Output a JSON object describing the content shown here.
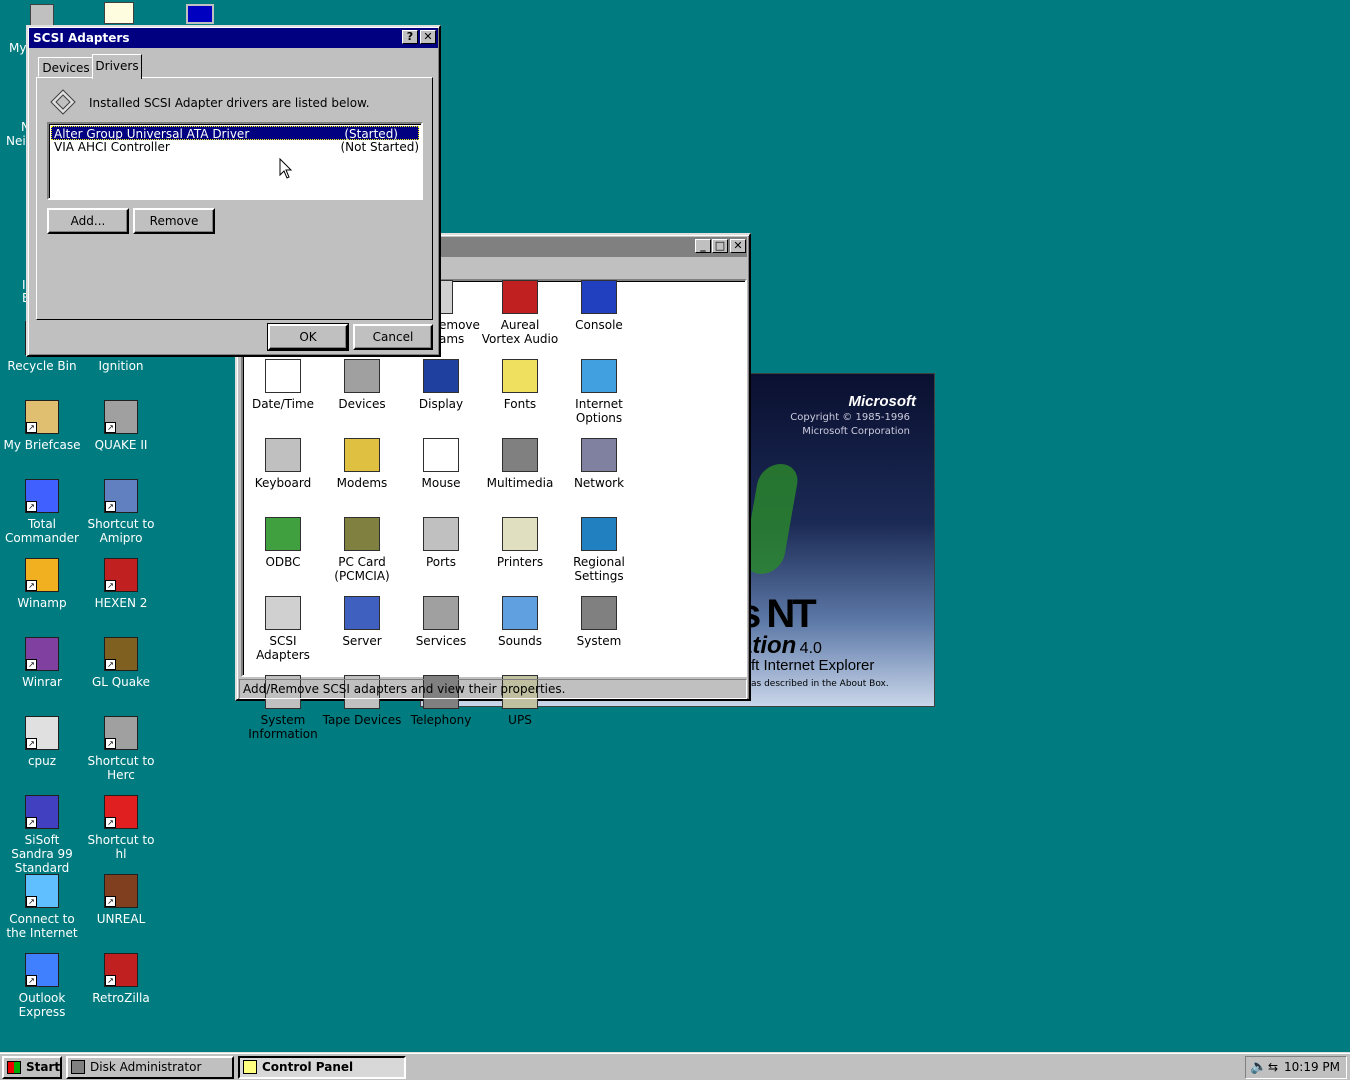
{
  "desktop": {
    "partial_labels": {
      "my": "My",
      "nei": "Nei",
      "n": "N",
      "e": "E",
      "l": "I"
    },
    "icons": [
      {
        "label": "Recycle Bin",
        "icon": "recycle-bin-icon"
      },
      {
        "label": "Ignition",
        "icon": "ignition-icon"
      },
      {
        "label": "My Briefcase",
        "icon": "briefcase-icon"
      },
      {
        "label": "QUAKE II",
        "icon": "quake2-icon"
      },
      {
        "label": "Total Commander",
        "icon": "total-commander-icon"
      },
      {
        "label": "Shortcut to Amipro",
        "icon": "amipro-icon"
      },
      {
        "label": "Winamp",
        "icon": "winamp-icon"
      },
      {
        "label": "HEXEN 2",
        "icon": "hexen2-icon"
      },
      {
        "label": "Winrar",
        "icon": "winrar-icon"
      },
      {
        "label": "GL Quake",
        "icon": "glquake-icon"
      },
      {
        "label": "cpuz",
        "icon": "cpuz-icon"
      },
      {
        "label": "Shortcut to Herc",
        "icon": "herc-icon"
      },
      {
        "label": "SiSoft Sandra 99 Standard",
        "icon": "sandra-icon"
      },
      {
        "label": "Shortcut to hl",
        "icon": "half-life-icon"
      },
      {
        "label": "Connect to the Internet",
        "icon": "connect-icon"
      },
      {
        "label": "UNREAL",
        "icon": "unreal-icon"
      },
      {
        "label": "Outlook Express",
        "icon": "outlook-express-icon"
      },
      {
        "label": "RetroZilla",
        "icon": "retrozilla-icon"
      }
    ]
  },
  "splash": {
    "brand": "Microsoft",
    "copyright": "Copyright © 1985-1996",
    "corp": "Microsoft Corporation",
    "nt": "s NT",
    "ation": "ation",
    "version": "4.0",
    "ie": "ft Internet Explorer",
    "about": "as described in the About Box."
  },
  "control_panel": {
    "items": [
      {
        "label": "emove ams",
        "icon": "add-remove-icon"
      },
      {
        "label": "Aureal Vortex Audio",
        "icon": "aureal-vortex-icon"
      },
      {
        "label": "Console",
        "icon": "console-icon"
      },
      {
        "label": "Date/Time",
        "icon": "date-time-icon"
      },
      {
        "label": "Devices",
        "icon": "devices-icon"
      },
      {
        "label": "Display",
        "icon": "display-icon"
      },
      {
        "label": "Fonts",
        "icon": "fonts-icon"
      },
      {
        "label": "Internet Options",
        "icon": "internet-options-icon"
      },
      {
        "label": "Keyboard",
        "icon": "keyboard-icon"
      },
      {
        "label": "Modems",
        "icon": "modems-icon"
      },
      {
        "label": "Mouse",
        "icon": "mouse-icon"
      },
      {
        "label": "Multimedia",
        "icon": "multimedia-icon"
      },
      {
        "label": "Network",
        "icon": "network-icon"
      },
      {
        "label": "ODBC",
        "icon": "odbc-icon"
      },
      {
        "label": "PC Card (PCMCIA)",
        "icon": "pc-card-icon"
      },
      {
        "label": "Ports",
        "icon": "ports-icon"
      },
      {
        "label": "Printers",
        "icon": "printers-icon"
      },
      {
        "label": "Regional Settings",
        "icon": "regional-settings-icon"
      },
      {
        "label": "SCSI Adapters",
        "icon": "scsi-adapters-icon"
      },
      {
        "label": "Server",
        "icon": "server-icon"
      },
      {
        "label": "Services",
        "icon": "services-icon"
      },
      {
        "label": "Sounds",
        "icon": "sounds-icon"
      },
      {
        "label": "System",
        "icon": "system-icon"
      },
      {
        "label": "System Information",
        "icon": "system-information-icon"
      },
      {
        "label": "Tape Devices",
        "icon": "tape-devices-icon"
      },
      {
        "label": "Telephony",
        "icon": "telephony-icon"
      },
      {
        "label": "UPS",
        "icon": "ups-icon"
      }
    ],
    "status": "Add/Remove SCSI adapters and view their properties."
  },
  "scsi_dialog": {
    "title": "SCSI Adapters",
    "help": "?",
    "close": "✕",
    "tabs": [
      "Devices",
      "Drivers"
    ],
    "active_tab": "Drivers",
    "info": "Installed SCSI Adapter drivers are listed below.",
    "drivers": [
      {
        "name": "Alter Group Universal ATA Driver",
        "status": "(Started)",
        "selected": true
      },
      {
        "name": "VIA AHCI Controller",
        "status": "(Not Started)",
        "selected": false
      }
    ],
    "add_label": "Add...",
    "remove_label": "Remove",
    "ok_label": "OK",
    "cancel_label": "Cancel"
  },
  "taskbar": {
    "start_label": "Start",
    "tasks": [
      {
        "label": "Disk Administrator",
        "active": false
      },
      {
        "label": "Control Panel",
        "active": true
      }
    ],
    "clock": "10:19 PM"
  },
  "colors": {
    "desktop": "#007c80",
    "titlebar_active": "#000080",
    "titlebar_inactive": "#808080",
    "face": "#c0c0c0"
  }
}
